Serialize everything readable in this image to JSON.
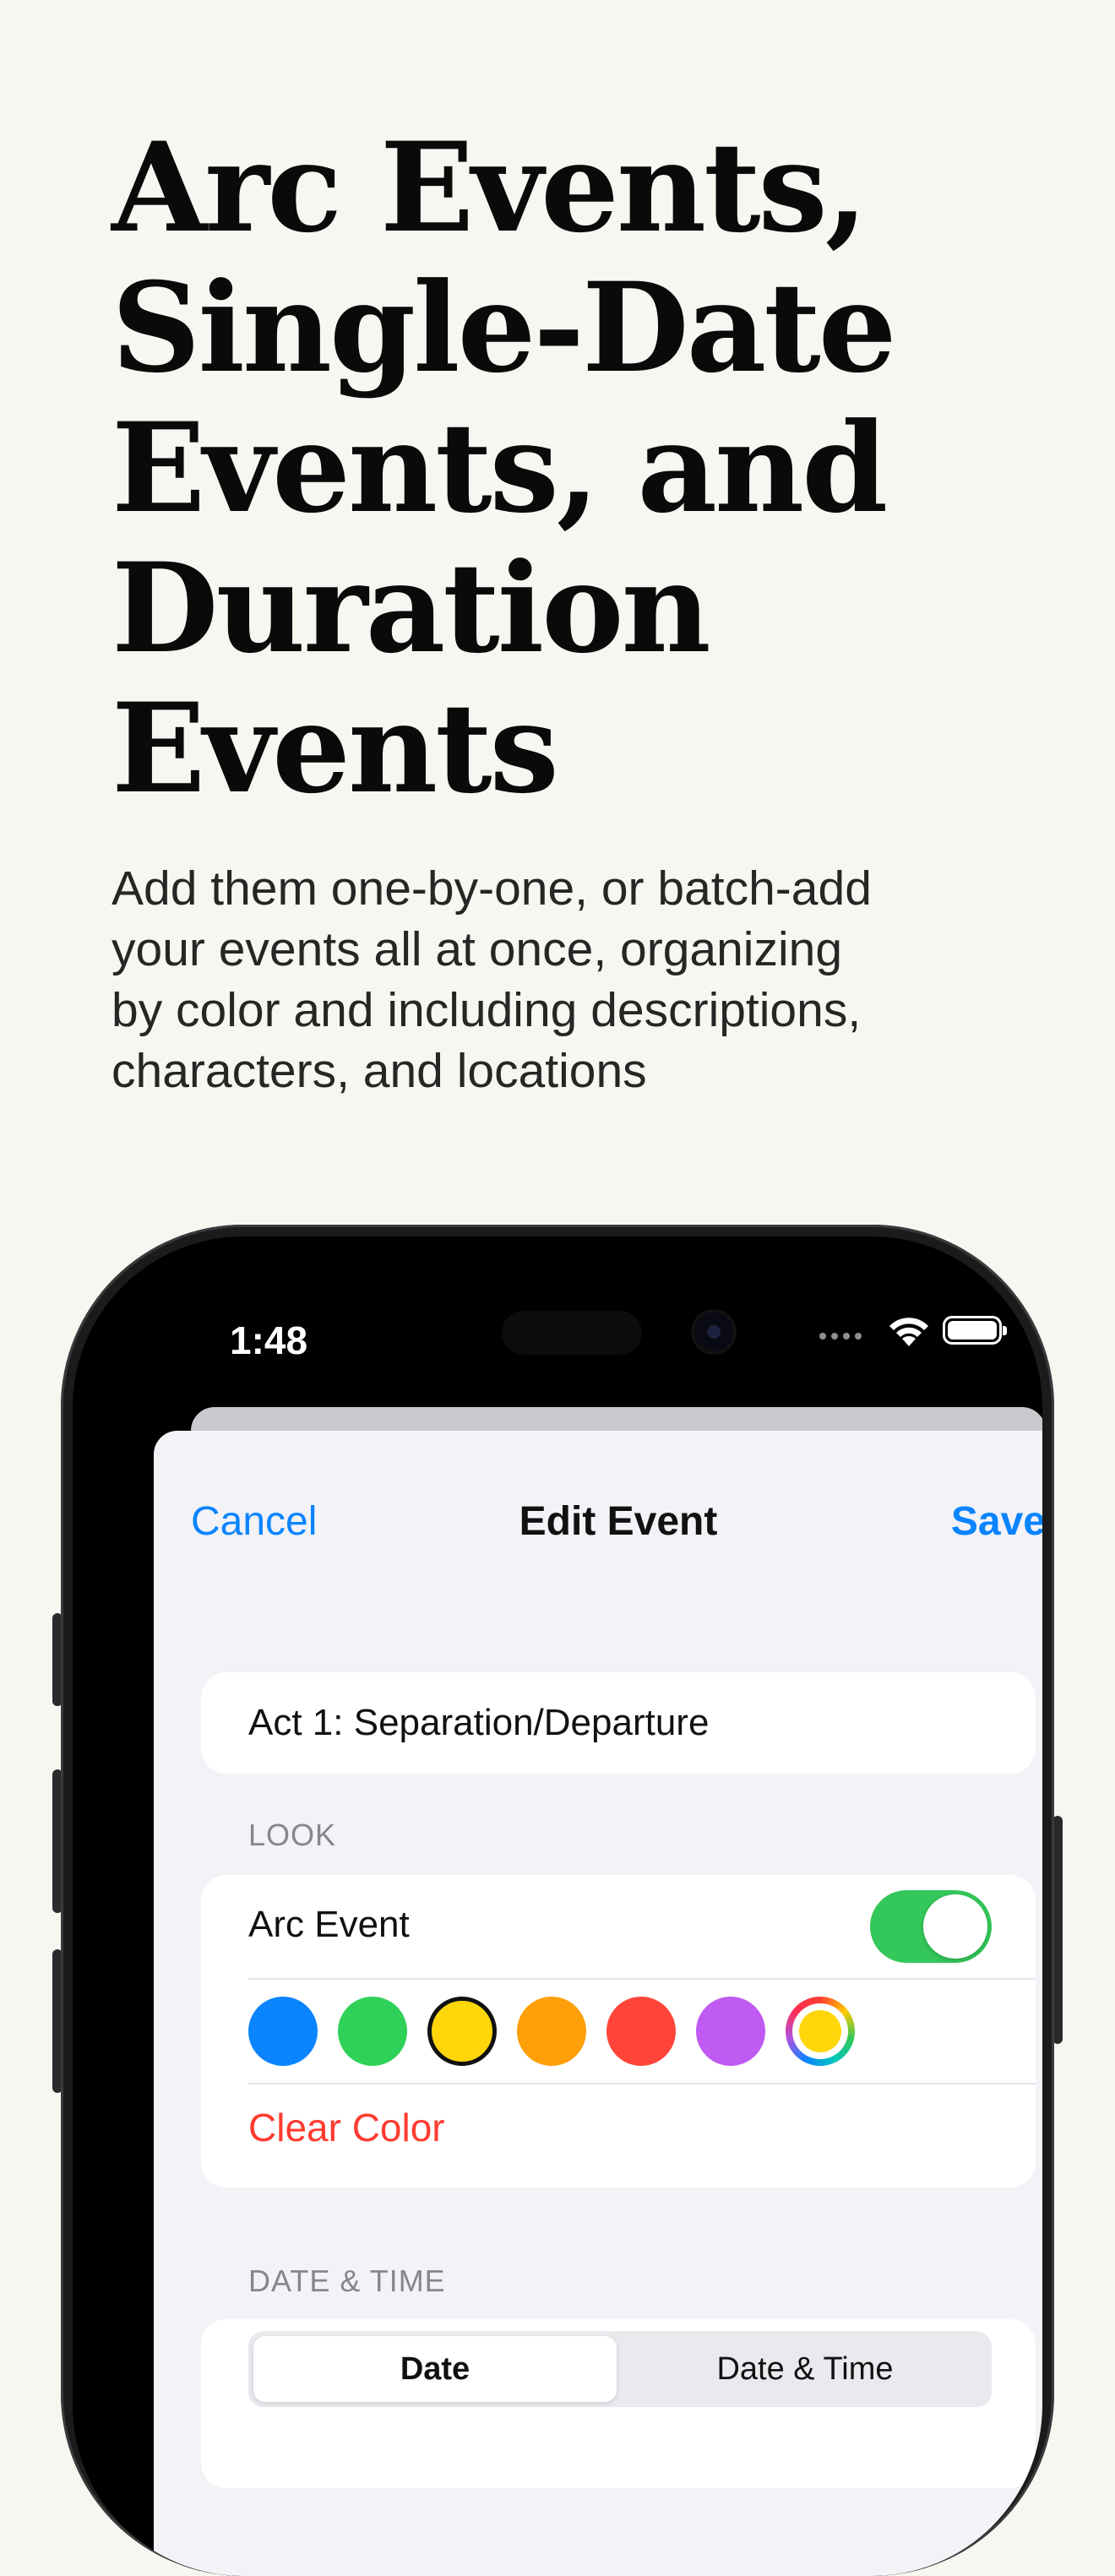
{
  "marketing": {
    "headline_lines": [
      "Arc Events,",
      "Single-Date",
      "Events, and",
      "Duration",
      "Events"
    ],
    "subhead_lines": [
      "Add them one-by-one, or batch-add",
      "your events all at once, organizing",
      "by color and including descriptions,",
      "characters, and locations"
    ]
  },
  "status_bar": {
    "time": "1:48"
  },
  "nav": {
    "cancel": "Cancel",
    "title": "Edit Event",
    "save": "Save"
  },
  "event_title": "Act 1: Separation/Departure",
  "look": {
    "section": "LOOK",
    "arc_event_label": "Arc Event",
    "arc_event_on": true,
    "swatches": [
      {
        "name": "blue",
        "color": "#0a84ff"
      },
      {
        "name": "green",
        "color": "#30d158"
      },
      {
        "name": "yellow",
        "color": "#ffd60a",
        "selected": true
      },
      {
        "name": "orange",
        "color": "#ff9f0a"
      },
      {
        "name": "red",
        "color": "#ff453a"
      },
      {
        "name": "purple",
        "color": "#bf5af2"
      }
    ],
    "clear_color": "Clear Color"
  },
  "date_time": {
    "section": "DATE & TIME",
    "segments": [
      "Date",
      "Date & Time"
    ],
    "selected_segment": "Date"
  }
}
